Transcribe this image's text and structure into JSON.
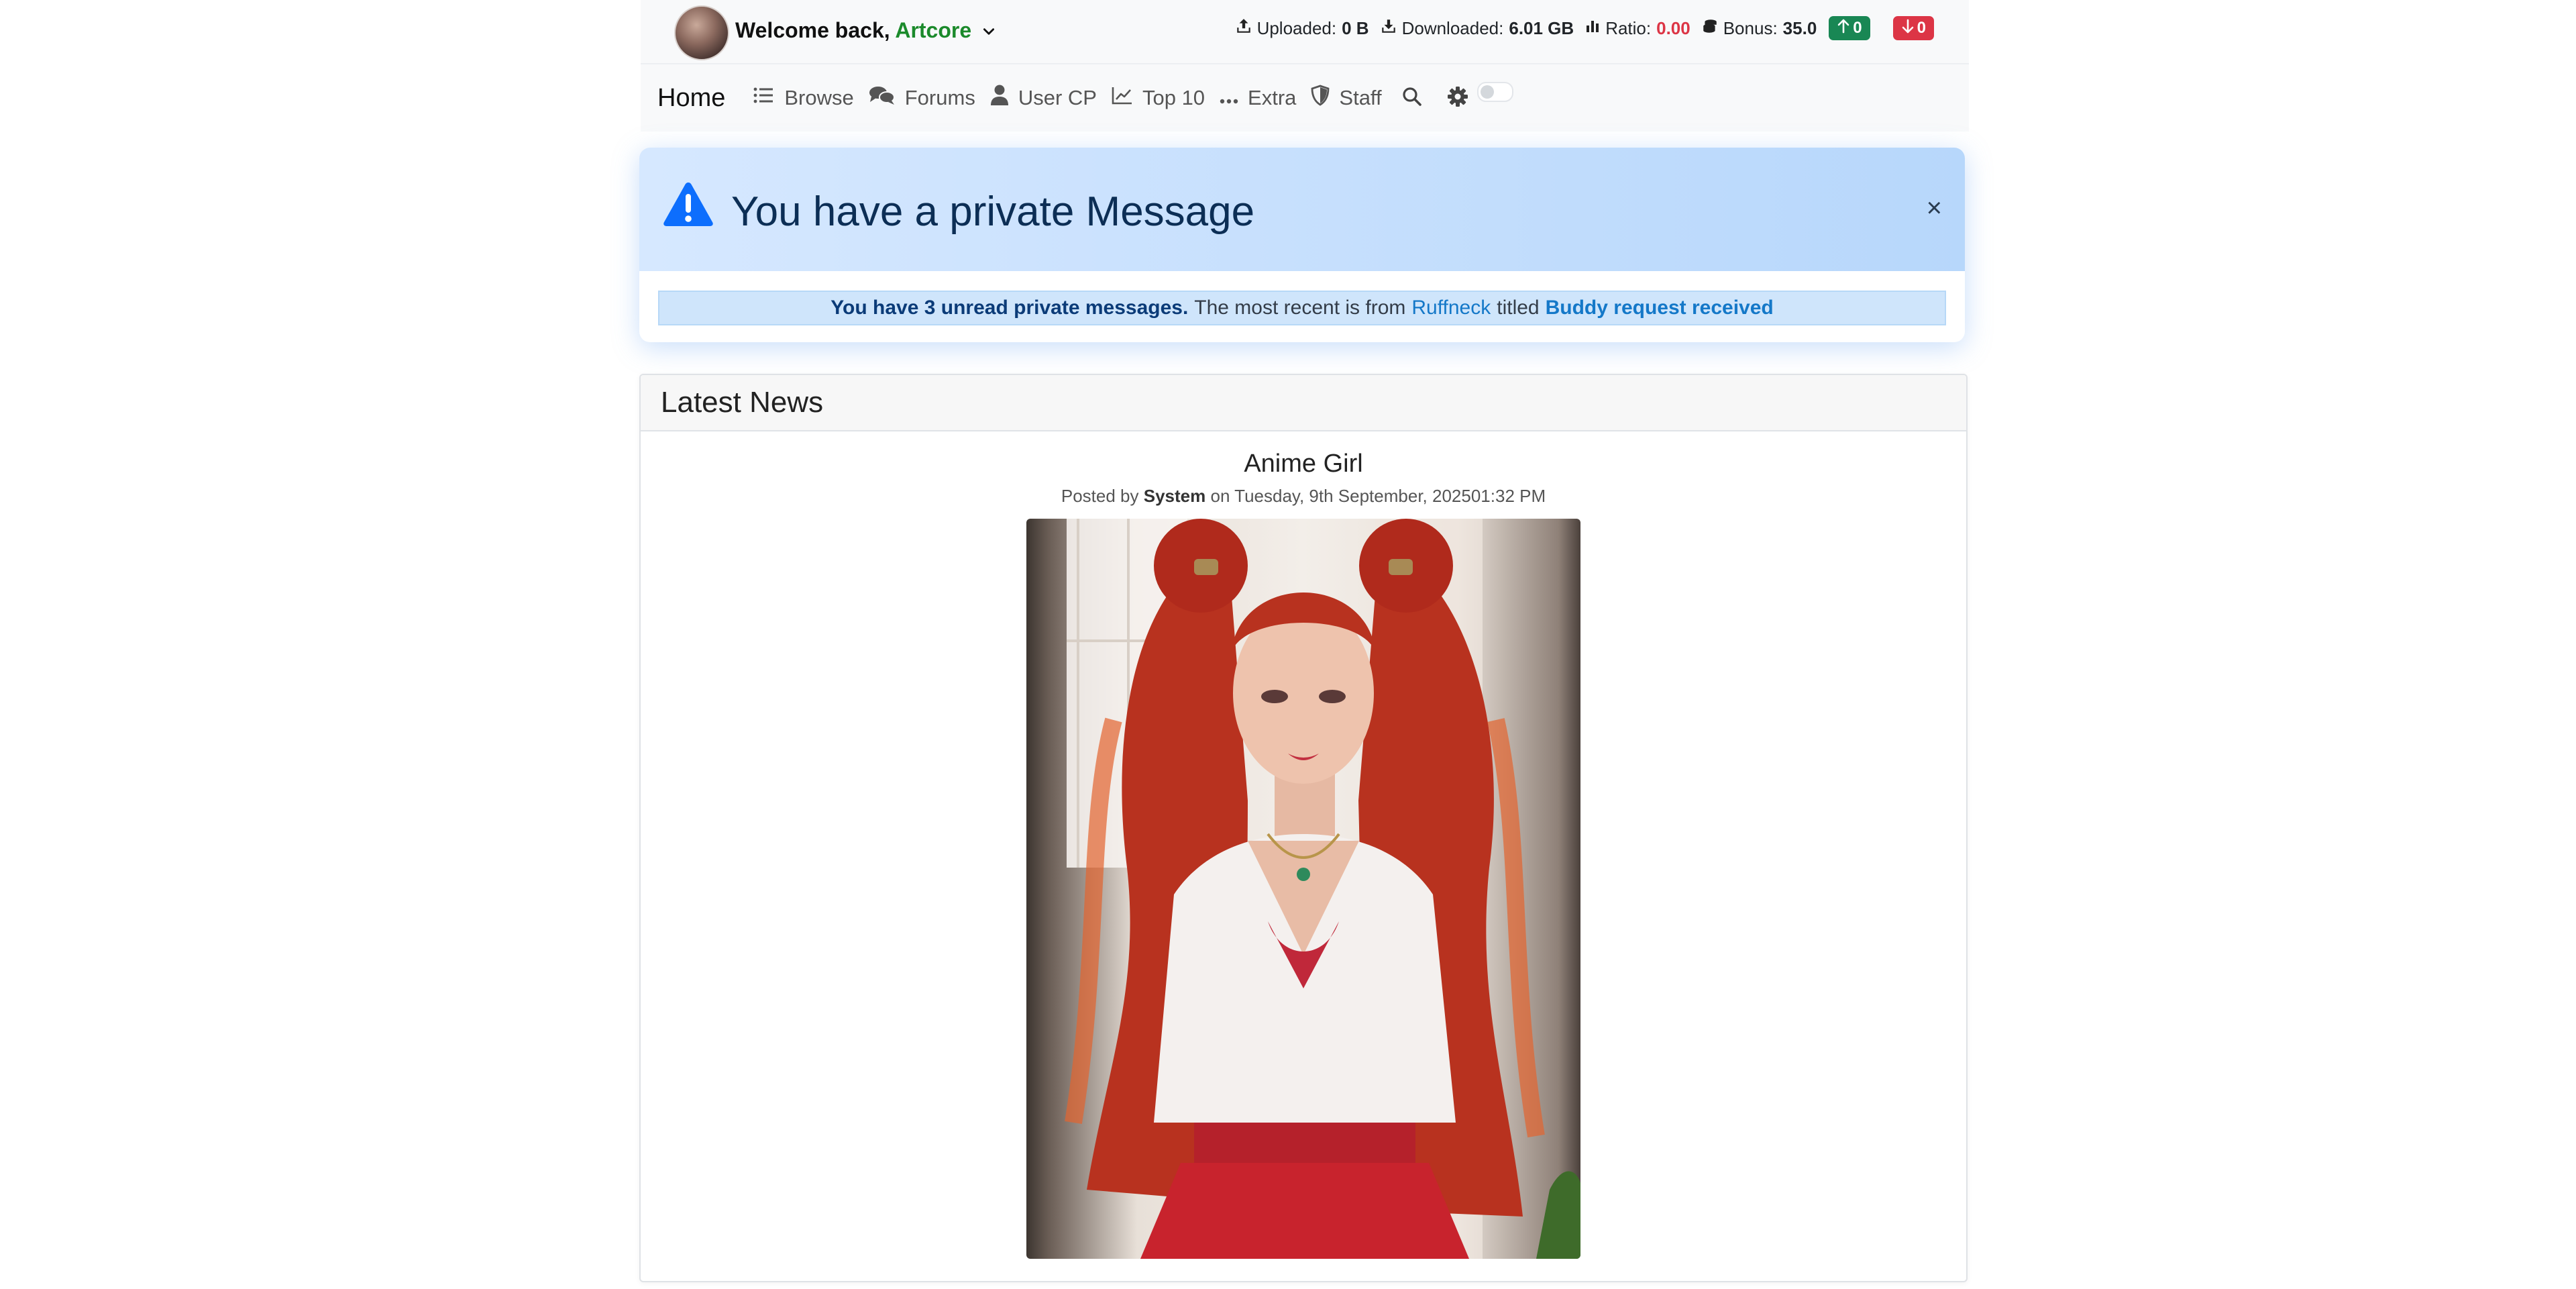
{
  "userbar": {
    "welcome_prefix": "Welcome back,",
    "username": "Artcore",
    "uploaded_label": "Uploaded:",
    "uploaded_value": "0 B",
    "downloaded_label": "Downloaded:",
    "downloaded_value": "6.01 GB",
    "ratio_label": "Ratio:",
    "ratio_value": "0.00",
    "bonus_label": "Bonus:",
    "bonus_value": "35.0",
    "seeding_count": "0",
    "leeching_count": "0"
  },
  "nav": {
    "home": "Home",
    "items": [
      {
        "label": "Browse",
        "icon": "list-icon"
      },
      {
        "label": "Forums",
        "icon": "comments-icon"
      },
      {
        "label": "User CP",
        "icon": "user-icon"
      },
      {
        "label": "Top 10",
        "icon": "chart-line-icon"
      },
      {
        "label": "Extra",
        "icon": "ellipsis-icon"
      },
      {
        "label": "Staff",
        "icon": "shield-icon"
      }
    ],
    "theme_toggle_on": false
  },
  "alert": {
    "title": "You have a private Message",
    "close": "×",
    "msg_strong": "You have 3 unread private messages.",
    "msg_text": "The most recent is from",
    "sender": "Ruffneck",
    "msg_titled": "titled",
    "subject": "Buddy request received"
  },
  "news": {
    "header": "Latest News",
    "post_title": "Anime Girl",
    "posted_by": "Posted by",
    "author": "System",
    "posted_on": "on Tuesday, 9th September, 202501:32 PM"
  },
  "colors": {
    "username": "#1b8a2b",
    "ratio": "#dc3545",
    "badge_up": "#198754",
    "badge_down": "#dc3545",
    "alert_accent": "#0d6efd",
    "link": "#1478c8"
  }
}
